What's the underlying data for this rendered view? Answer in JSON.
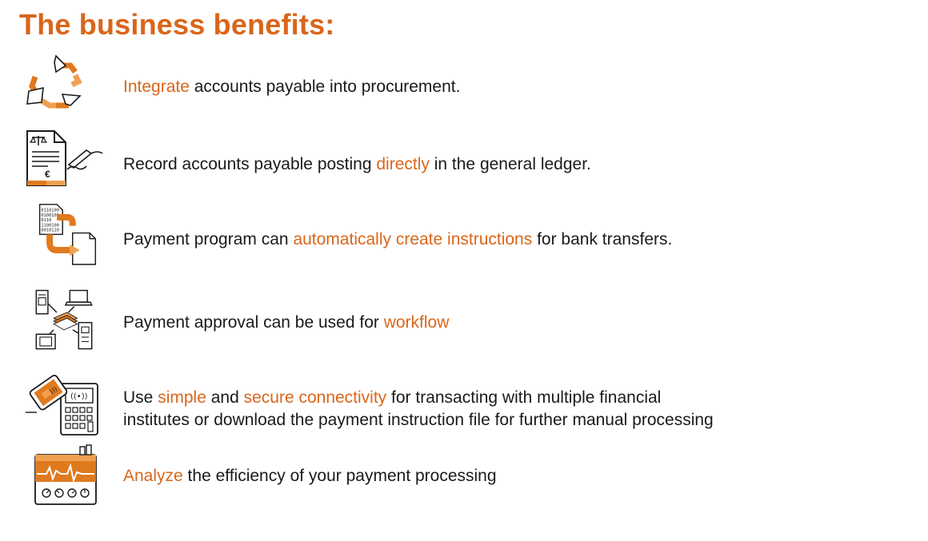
{
  "title": "The business benefits:",
  "colors": {
    "accent": "#d9661a",
    "accent_light": "#f0a050",
    "text": "#1a1a1a"
  },
  "benefits": [
    {
      "icon": "cycle-arrows-icon",
      "segments": [
        {
          "text": "Integrate",
          "highlight": true
        },
        {
          "text": " accounts payable into procurement.",
          "highlight": false
        }
      ]
    },
    {
      "icon": "signed-document-euro-icon",
      "segments": [
        {
          "text": "Record accounts payable posting ",
          "highlight": false
        },
        {
          "text": "directly",
          "highlight": true
        },
        {
          "text": " in the general ledger.",
          "highlight": false
        }
      ]
    },
    {
      "icon": "binary-file-transfer-icon",
      "segments": [
        {
          "text": "Payment program can ",
          "highlight": false
        },
        {
          "text": "automatically create instructions",
          "highlight": true
        },
        {
          "text": " for bank transfers.",
          "highlight": false
        }
      ]
    },
    {
      "icon": "network-devices-money-icon",
      "segments": [
        {
          "text": "Payment approval can be used for ",
          "highlight": false
        },
        {
          "text": "workflow",
          "highlight": true
        }
      ]
    },
    {
      "icon": "contactless-payment-terminal-icon",
      "lines": [
        [
          {
            "text": "Use ",
            "highlight": false
          },
          {
            "text": "simple",
            "highlight": true
          },
          {
            "text": " and ",
            "highlight": false
          },
          {
            "text": "secure connectivity",
            "highlight": true
          },
          {
            "text": " for transacting with multiple financial",
            "highlight": false
          }
        ],
        [
          {
            "text": "institutes or download the payment instruction file for further manual processing",
            "highlight": false
          }
        ]
      ]
    },
    {
      "icon": "pulse-analytics-device-icon",
      "segments": [
        {
          "text": "Analyze",
          "highlight": true
        },
        {
          "text": " the efficiency of your payment processing",
          "highlight": false
        }
      ]
    }
  ]
}
